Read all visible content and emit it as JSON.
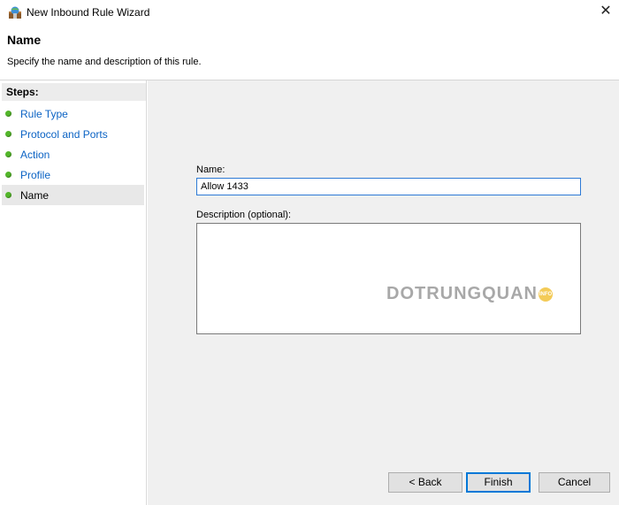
{
  "window": {
    "title": "New Inbound Rule Wizard",
    "close_glyph": "✕"
  },
  "header": {
    "heading": "Name",
    "subtitle": "Specify the name and description of this rule."
  },
  "steps": {
    "header": "Steps:",
    "items": [
      {
        "label": "Rule Type"
      },
      {
        "label": "Protocol and Ports"
      },
      {
        "label": "Action"
      },
      {
        "label": "Profile"
      },
      {
        "label": "Name"
      }
    ],
    "current_index": 4
  },
  "form": {
    "name_label": "Name:",
    "name_value": "Allow 1433",
    "description_label": "Description (optional):",
    "description_value": ""
  },
  "watermark": {
    "text": "DOTRUNGQUAN",
    "badge": "INFO"
  },
  "buttons": {
    "back": "< Back",
    "finish": "Finish",
    "cancel": "Cancel"
  },
  "colors": {
    "link": "#0b63c4",
    "step_dot": "#53b62a",
    "focus_border": "#0078d7"
  }
}
